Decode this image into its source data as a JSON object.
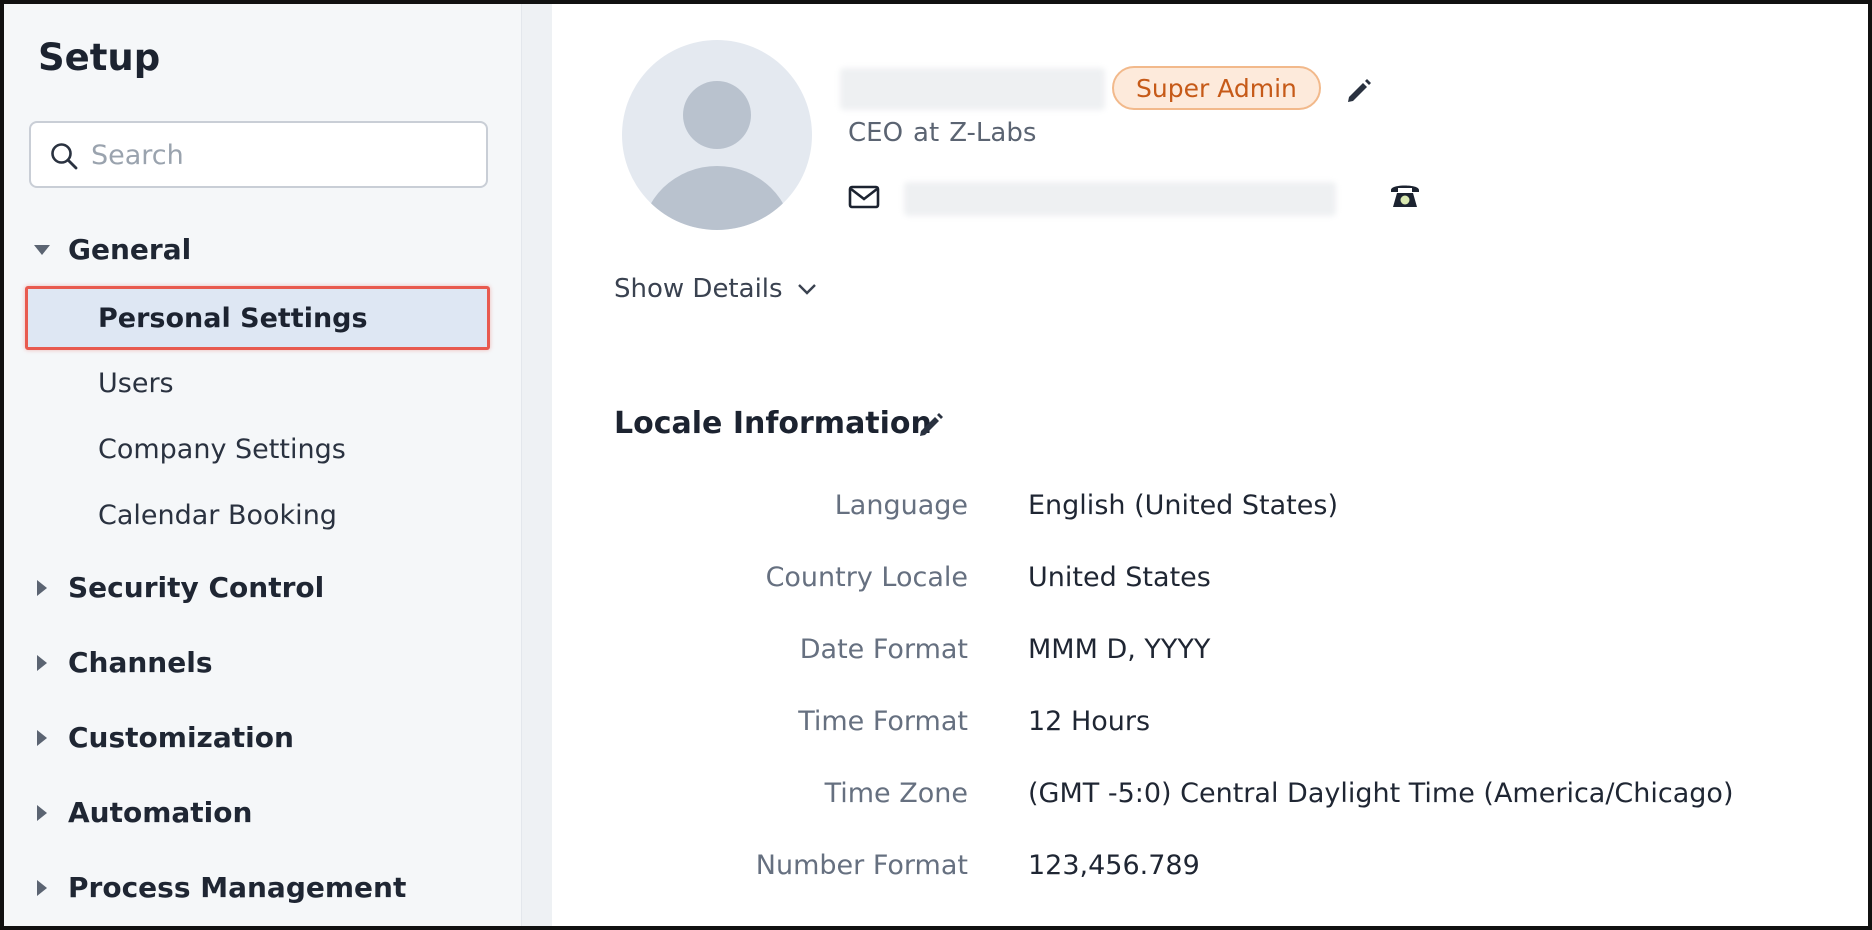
{
  "sidebar": {
    "title": "Setup",
    "search_placeholder": "Search",
    "groups": [
      {
        "label": "General",
        "expanded": true
      },
      {
        "label": "Security Control",
        "expanded": false
      },
      {
        "label": "Channels",
        "expanded": false
      },
      {
        "label": "Customization",
        "expanded": false
      },
      {
        "label": "Automation",
        "expanded": false
      },
      {
        "label": "Process Management",
        "expanded": false
      }
    ],
    "general_items": [
      {
        "label": "Personal Settings",
        "active": true
      },
      {
        "label": "Users"
      },
      {
        "label": "Company Settings"
      },
      {
        "label": "Calendar Booking"
      }
    ]
  },
  "profile": {
    "role_badge": "Super Admin",
    "job_title": "CEO",
    "at_word": "at",
    "company": "Z-Labs",
    "show_details": "Show Details"
  },
  "locale": {
    "section_title": "Locale Information",
    "rows": [
      {
        "label": "Language",
        "value": "English (United States)"
      },
      {
        "label": "Country Locale",
        "value": "United States"
      },
      {
        "label": "Date Format",
        "value": "MMM D, YYYY"
      },
      {
        "label": "Time Format",
        "value": "12 Hours"
      },
      {
        "label": "Time Zone",
        "value": "(GMT -5:0) Central Daylight Time (America/Chicago)"
      },
      {
        "label": "Number Format",
        "value": "123,456.789"
      }
    ]
  },
  "colors": {
    "badge_text": "#c65a18",
    "badge_bg": "#fdeadb",
    "active_highlight": "#e85a4f"
  }
}
